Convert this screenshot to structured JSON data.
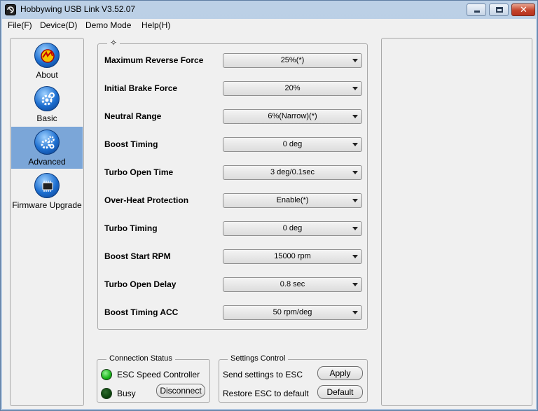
{
  "window": {
    "title": "Hobbywing USB Link V3.52.07",
    "close_glyph": "✕"
  },
  "menu": {
    "items": [
      {
        "label": "File(F)"
      },
      {
        "label": "Device(D)"
      },
      {
        "label": "Demo Mode"
      },
      {
        "label": "Help(H)"
      }
    ]
  },
  "sidebar": {
    "items": [
      {
        "label": "About",
        "icon": "hobbywing-logo-icon"
      },
      {
        "label": "Basic",
        "icon": "gear-icon"
      },
      {
        "label": "Advanced",
        "icon": "gears-icon"
      },
      {
        "label": "Firmware Upgrade",
        "icon": "chip-icon"
      }
    ],
    "active_index": 2,
    "active_color": "#7ba6d8"
  },
  "parameters": {
    "group_title": "✧",
    "rows": [
      {
        "label": "Maximum Reverse Force",
        "value": "25%(*)"
      },
      {
        "label": "Initial Brake Force",
        "value": "20%"
      },
      {
        "label": "Neutral Range",
        "value": "6%(Narrow)(*)"
      },
      {
        "label": "Boost Timing",
        "value": "0 deg"
      },
      {
        "label": "Turbo Open Time",
        "value": "3 deg/0.1sec"
      },
      {
        "label": "Over-Heat Protection",
        "value": "Enable(*)"
      },
      {
        "label": "Turbo Timing",
        "value": "0 deg"
      },
      {
        "label": "Boost Start RPM",
        "value": "15000 rpm"
      },
      {
        "label": "Turbo Open Delay",
        "value": "0.8 sec"
      },
      {
        "label": "Boost Timing ACC",
        "value": "50 rpm/deg"
      }
    ]
  },
  "connection": {
    "title": "Connection Status",
    "device_label": "ESC Speed Controller",
    "busy_label": "Busy",
    "disconnect_label": "Disconnect",
    "connected_color": "#18b418",
    "busy_color": "#0e4510"
  },
  "settings": {
    "title": "Settings Control",
    "send_label": "Send settings to ESC",
    "apply_label": "Apply",
    "restore_label": "Restore ESC to default",
    "default_label": "Default"
  }
}
